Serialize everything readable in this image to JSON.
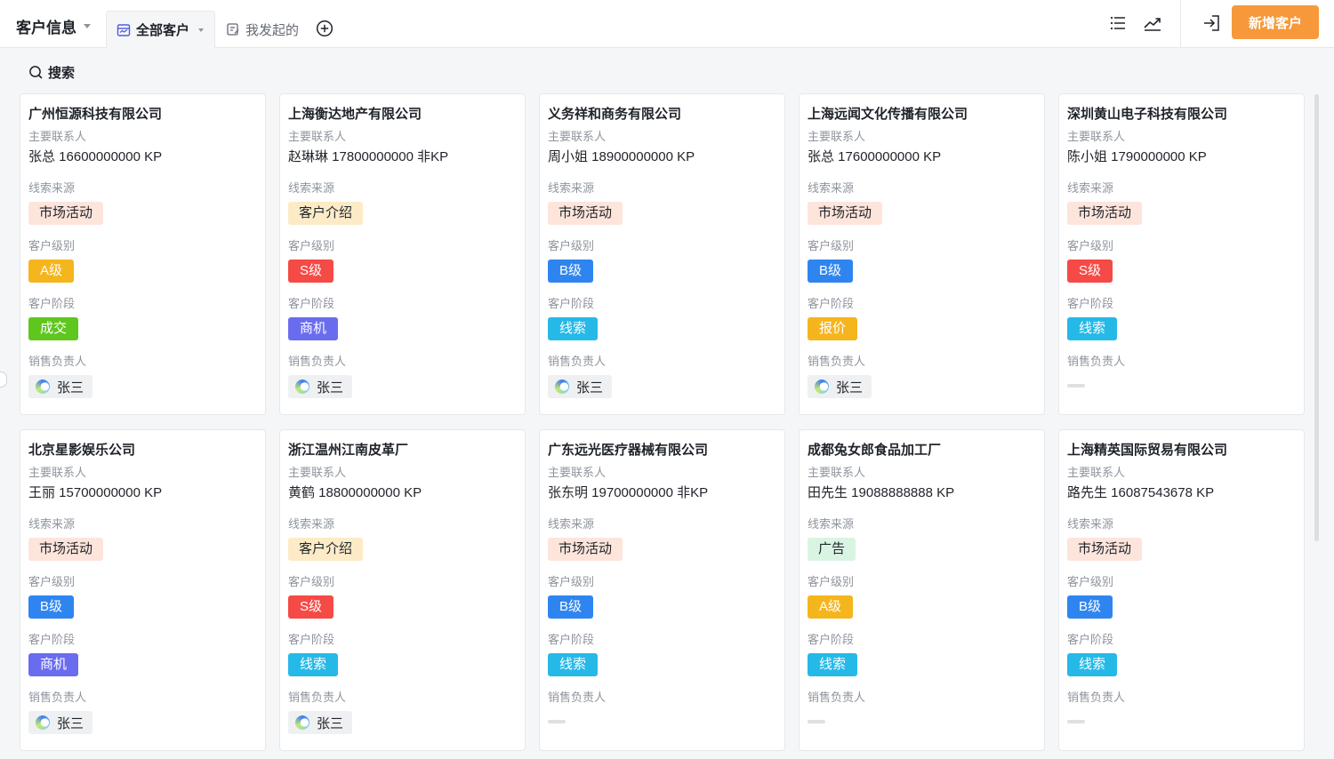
{
  "header": {
    "app_title": "客户信息",
    "tabs": [
      {
        "label": "全部客户"
      },
      {
        "label": "我发起的"
      }
    ],
    "new_button": "新增客户"
  },
  "search": {
    "label": "搜索"
  },
  "field_labels": {
    "contact": "主要联系人",
    "source": "线索来源",
    "level": "客户级别",
    "stage": "客户阶段",
    "owner": "销售负责人"
  },
  "colors": {
    "accent": "#f7993a",
    "level_A": "#f5b51c",
    "level_S": "#f54a45",
    "level_B": "#2f85f0",
    "stage_deal": "#5fc61d",
    "stage_opportunity": "#6a6cf0",
    "stage_lead": "#25b9e8",
    "stage_quote": "#f5b51c"
  },
  "customers": [
    {
      "name": "广州恒源科技有限公司",
      "contact": "张总 16600000000 KP",
      "source": "市场活动",
      "source_kind": "market",
      "level": "A级",
      "level_color": "#f5b51c",
      "stage": "成交",
      "stage_color": "#5fc61d",
      "owner": "张三"
    },
    {
      "name": "上海衡达地产有限公司",
      "contact": "赵琳琳 17800000000 非KP",
      "source": "客户介绍",
      "source_kind": "intro",
      "level": "S级",
      "level_color": "#f54a45",
      "stage": "商机",
      "stage_color": "#6a6cf0",
      "owner": "张三"
    },
    {
      "name": "义务祥和商务有限公司",
      "contact": "周小姐 18900000000 KP",
      "source": "市场活动",
      "source_kind": "market",
      "level": "B级",
      "level_color": "#2f85f0",
      "stage": "线索",
      "stage_color": "#25b9e8",
      "owner": "张三"
    },
    {
      "name": "上海远闻文化传播有限公司",
      "contact": "张总 17600000000 KP",
      "source": "市场活动",
      "source_kind": "market",
      "level": "B级",
      "level_color": "#2f85f0",
      "stage": "报价",
      "stage_color": "#f5b51c",
      "owner": "张三"
    },
    {
      "name": "深圳黄山电子科技有限公司",
      "contact": "陈小姐 1790000000 KP",
      "source": "市场活动",
      "source_kind": "market",
      "level": "S级",
      "level_color": "#f54a45",
      "stage": "线索",
      "stage_color": "#25b9e8",
      "owner": ""
    },
    {
      "name": "北京星影娱乐公司",
      "contact": "王丽 15700000000 KP",
      "source": "市场活动",
      "source_kind": "market",
      "level": "B级",
      "level_color": "#2f85f0",
      "stage": "商机",
      "stage_color": "#6a6cf0",
      "owner": "张三"
    },
    {
      "name": "浙江温州江南皮革厂",
      "contact": "黄鹤 18800000000 KP",
      "source": "客户介绍",
      "source_kind": "intro",
      "level": "S级",
      "level_color": "#f54a45",
      "stage": "线索",
      "stage_color": "#25b9e8",
      "owner": "张三"
    },
    {
      "name": "广东远光医疗器械有限公司",
      "contact": "张东明 19700000000 非KP",
      "source": "市场活动",
      "source_kind": "market",
      "level": "B级",
      "level_color": "#2f85f0",
      "stage": "线索",
      "stage_color": "#25b9e8",
      "owner": ""
    },
    {
      "name": "成都兔女郎食品加工厂",
      "contact": "田先生 19088888888 KP",
      "source": "广告",
      "source_kind": "ad",
      "level": "A级",
      "level_color": "#f5b51c",
      "stage": "线索",
      "stage_color": "#25b9e8",
      "owner": ""
    },
    {
      "name": "上海精英国际贸易有限公司",
      "contact": "路先生 16087543678 KP",
      "source": "市场活动",
      "source_kind": "market",
      "level": "B级",
      "level_color": "#2f85f0",
      "stage": "线索",
      "stage_color": "#25b9e8",
      "owner": ""
    }
  ]
}
